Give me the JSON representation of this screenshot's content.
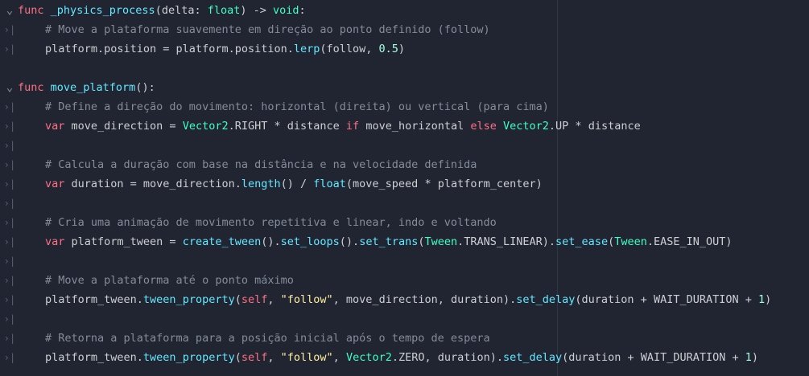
{
  "editor": {
    "fold_icon": "chevron-down-icon",
    "indent_icon": "tab-marker-icon",
    "fold_glyph": "⌄",
    "tab_glyph": "›|",
    "colors": {
      "background": "#202531",
      "keyword": "#ff7085",
      "function": "#66e6ff",
      "type": "#42ffc2",
      "comment": "#858c99",
      "number": "#a1ffe0",
      "string": "#ffeda1",
      "text": "#cdcfd2"
    }
  },
  "lines": [
    {
      "gutter": "fold",
      "indent": false,
      "tokens": [
        {
          "t": "kw",
          "v": "func "
        },
        {
          "t": "name",
          "v": "_physics_process"
        },
        {
          "t": "plain",
          "v": "(delta: "
        },
        {
          "t": "type",
          "v": "float"
        },
        {
          "t": "plain",
          "v": ") -> "
        },
        {
          "t": "type",
          "v": "void"
        },
        {
          "t": "plain",
          "v": ":"
        }
      ]
    },
    {
      "gutter": "tab",
      "indent": true,
      "tokens": [
        {
          "t": "cm",
          "v": "# Move a plataforma suavemente em direção ao ponto definido (follow)"
        }
      ]
    },
    {
      "gutter": "tab",
      "indent": true,
      "tokens": [
        {
          "t": "plain",
          "v": "platform.position = platform.position."
        },
        {
          "t": "name",
          "v": "lerp"
        },
        {
          "t": "plain",
          "v": "(follow, "
        },
        {
          "t": "num",
          "v": "0.5"
        },
        {
          "t": "plain",
          "v": ")"
        }
      ]
    },
    {
      "gutter": "none",
      "indent": false,
      "tokens": []
    },
    {
      "gutter": "fold",
      "indent": false,
      "tokens": [
        {
          "t": "kw",
          "v": "func "
        },
        {
          "t": "name",
          "v": "move_platform"
        },
        {
          "t": "plain",
          "v": "():"
        }
      ]
    },
    {
      "gutter": "tab",
      "indent": true,
      "tokens": [
        {
          "t": "cm",
          "v": "# Define a direção do movimento: horizontal (direita) ou vertical (para cima)"
        }
      ]
    },
    {
      "gutter": "tab",
      "indent": true,
      "tokens": [
        {
          "t": "kw",
          "v": "var"
        },
        {
          "t": "plain",
          "v": " move_direction = "
        },
        {
          "t": "type",
          "v": "Vector2"
        },
        {
          "t": "plain",
          "v": ".RIGHT * distance "
        },
        {
          "t": "kw",
          "v": "if"
        },
        {
          "t": "plain",
          "v": " move_horizontal "
        },
        {
          "t": "kw",
          "v": "else"
        },
        {
          "t": "plain",
          "v": " "
        },
        {
          "t": "type",
          "v": "Vector2"
        },
        {
          "t": "plain",
          "v": ".UP * distance"
        }
      ]
    },
    {
      "gutter": "tab",
      "indent": true,
      "tokens": []
    },
    {
      "gutter": "tab",
      "indent": true,
      "tokens": [
        {
          "t": "cm",
          "v": "# Calcula a duração com base na distância e na velocidade definida"
        }
      ]
    },
    {
      "gutter": "tab",
      "indent": true,
      "tokens": [
        {
          "t": "kw",
          "v": "var"
        },
        {
          "t": "plain",
          "v": " duration = move_direction."
        },
        {
          "t": "name",
          "v": "length"
        },
        {
          "t": "plain",
          "v": "() / "
        },
        {
          "t": "name",
          "v": "float"
        },
        {
          "t": "plain",
          "v": "(move_speed * platform_center)"
        }
      ]
    },
    {
      "gutter": "tab",
      "indent": true,
      "tokens": []
    },
    {
      "gutter": "tab",
      "indent": true,
      "tokens": [
        {
          "t": "cm",
          "v": "# Cria uma animação de movimento repetitiva e linear, indo e voltando"
        }
      ]
    },
    {
      "gutter": "tab",
      "indent": true,
      "tokens": [
        {
          "t": "kw",
          "v": "var"
        },
        {
          "t": "plain",
          "v": " platform_tween = "
        },
        {
          "t": "name",
          "v": "create_tween"
        },
        {
          "t": "plain",
          "v": "()."
        },
        {
          "t": "name",
          "v": "set_loops"
        },
        {
          "t": "plain",
          "v": "()."
        },
        {
          "t": "name",
          "v": "set_trans"
        },
        {
          "t": "plain",
          "v": "("
        },
        {
          "t": "type",
          "v": "Tween"
        },
        {
          "t": "plain",
          "v": ".TRANS_LINEAR)."
        },
        {
          "t": "name",
          "v": "set_ease"
        },
        {
          "t": "plain",
          "v": "("
        },
        {
          "t": "type",
          "v": "Tween"
        },
        {
          "t": "plain",
          "v": ".EASE_IN_OUT)"
        }
      ]
    },
    {
      "gutter": "tab",
      "indent": true,
      "tokens": []
    },
    {
      "gutter": "tab",
      "indent": true,
      "tokens": [
        {
          "t": "cm",
          "v": "# Move a plataforma até o ponto máximo"
        }
      ]
    },
    {
      "gutter": "tab",
      "indent": true,
      "tokens": [
        {
          "t": "plain",
          "v": "platform_tween."
        },
        {
          "t": "name",
          "v": "tween_property"
        },
        {
          "t": "plain",
          "v": "("
        },
        {
          "t": "kw",
          "v": "self"
        },
        {
          "t": "plain",
          "v": ", "
        },
        {
          "t": "str",
          "v": "\"follow\""
        },
        {
          "t": "plain",
          "v": ", move_direction, duration)."
        },
        {
          "t": "name",
          "v": "set_delay"
        },
        {
          "t": "plain",
          "v": "(duration + WAIT_DURATION + "
        },
        {
          "t": "num",
          "v": "1"
        },
        {
          "t": "plain",
          "v": ")"
        }
      ]
    },
    {
      "gutter": "tab",
      "indent": true,
      "tokens": []
    },
    {
      "gutter": "tab",
      "indent": true,
      "tokens": [
        {
          "t": "cm",
          "v": "# Retorna a plataforma para a posição inicial após o tempo de espera"
        }
      ]
    },
    {
      "gutter": "tab",
      "indent": true,
      "tokens": [
        {
          "t": "plain",
          "v": "platform_tween."
        },
        {
          "t": "name",
          "v": "tween_property"
        },
        {
          "t": "plain",
          "v": "("
        },
        {
          "t": "kw",
          "v": "self"
        },
        {
          "t": "plain",
          "v": ", "
        },
        {
          "t": "str",
          "v": "\"follow\""
        },
        {
          "t": "plain",
          "v": ", "
        },
        {
          "t": "type",
          "v": "Vector2"
        },
        {
          "t": "plain",
          "v": ".ZERO, duration)."
        },
        {
          "t": "name",
          "v": "set_delay"
        },
        {
          "t": "plain",
          "v": "(duration + WAIT_DURATION + "
        },
        {
          "t": "num",
          "v": "1"
        },
        {
          "t": "plain",
          "v": ")"
        }
      ]
    }
  ]
}
